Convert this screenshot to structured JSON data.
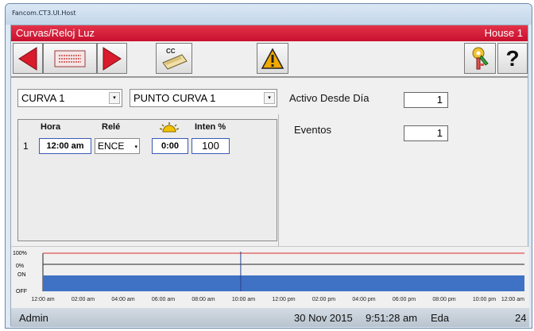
{
  "window": {
    "title": "Fancom.CT3.UI.Host"
  },
  "header": {
    "title": "Curvas/Reloj Luz",
    "house": "House 1"
  },
  "toolbar": {
    "cc_label": "CC",
    "help_label": "?",
    "icons": [
      "prev-arrow-icon",
      "list-icon",
      "next-arrow-icon",
      "cc-print-icon",
      "warning-icon",
      "key-icon",
      "help-icon"
    ],
    "colors": {
      "arrow": "#d81c2b",
      "warning": "#f2a900"
    }
  },
  "selectors": {
    "curve": "CURVA 1",
    "point": "PUNTO CURVA 1"
  },
  "active_since": {
    "label": "Activo Desde Día",
    "value": "1"
  },
  "events": {
    "label": "Eventos",
    "value": "1"
  },
  "table": {
    "headers": {
      "hour": "Hora",
      "relay": "Relé",
      "intensity": "Inten %"
    },
    "rows": [
      {
        "index": "1",
        "hour": "12:00 am",
        "relay": "ENCE",
        "dim_time": "0:00",
        "intensity": "100"
      }
    ]
  },
  "graph": {
    "y_labels": {
      "top": "100%",
      "zero": "0%",
      "on": "ON",
      "off": "OFF"
    },
    "x_labels": [
      "12:00 am",
      "02:00 am",
      "04:00 am",
      "06:00 am",
      "08:00 am",
      "10:00 am",
      "12:00 pm",
      "02:00 pm",
      "04:00 pm",
      "06:00 pm",
      "08:00 pm",
      "10:00 pm",
      "12:00 am"
    ],
    "colors": {
      "intensity_line": "#e05050",
      "on_area": "#3f72c4",
      "current_time": "#2a3f8f"
    },
    "intensity_percent": 100,
    "relay_state": "ON"
  },
  "status": {
    "user": "Admin",
    "date": "30 Nov 2015",
    "time": "9:51:28 am",
    "eda_label": "Eda",
    "eda_value": "24"
  }
}
